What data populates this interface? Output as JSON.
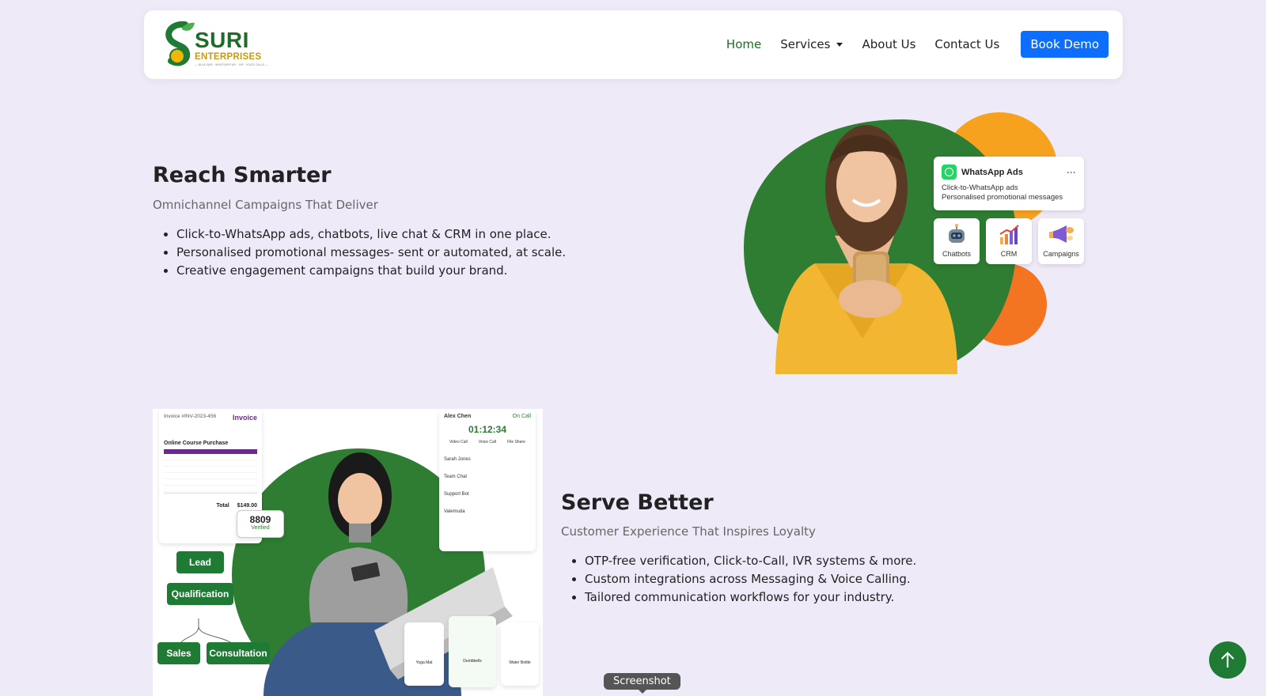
{
  "nav": {
    "logo": {
      "name": "SURI",
      "sub": "ENTERPRISES",
      "tag": "— BULK SMS · WHATSAPP API · IVR · VOICE CALLS —"
    },
    "links": [
      {
        "label": "Home",
        "active": true
      },
      {
        "label": "Services",
        "dropdown": true
      },
      {
        "label": "About Us"
      },
      {
        "label": "Contact Us"
      }
    ],
    "cta": "Book Demo"
  },
  "section1": {
    "title": "Reach Smarter",
    "subtitle": "Omnichannel Campaigns That Deliver",
    "bullets": [
      "Click-to-WhatsApp ads, chatbots, live chat & CRM in one place.",
      "Personalised promotional messages- sent or automated, at scale.",
      "Creative engagement campaigns that build your brand."
    ],
    "image": {
      "wa_card": {
        "title": "WhatsApp Ads",
        "line1": "Click-to-WhatsApp ads",
        "line2": "Personalised promotional messages"
      },
      "mini_cards": [
        "Chatbots",
        "CRM",
        "Campaigns"
      ]
    }
  },
  "section2": {
    "title": "Serve Better",
    "subtitle": "Customer Experience That Inspires Loyalty",
    "bullets": [
      "OTP-free verification, Click-to-Call, IVR systems & more.",
      "Custom integrations across Messaging & Voice Calling.",
      "Tailored communication workflows for your industry."
    ],
    "image": {
      "invoice": {
        "number": "Invoice #INV-2023-456",
        "label": "Invoice",
        "item": "Online Course Purchase",
        "total_label": "Total",
        "total_value": "$149.00"
      },
      "otp": {
        "code": "8809",
        "status": "Verified"
      },
      "call": {
        "name": "Alex Chen",
        "status": "On Call",
        "timer": "01:12:34",
        "actions": [
          "Video Call",
          "Voice Call",
          "File Share"
        ]
      },
      "chats": [
        "Sarah Jones",
        "Team Chat",
        "Support Bot",
        "Valemuda"
      ],
      "flow": [
        "Lead",
        "Qualification",
        "Sales",
        "Consultation"
      ],
      "products": [
        "Yoga Mat",
        "Dumbbells",
        "Water Bottle"
      ]
    }
  },
  "tooltip": "Screenshot",
  "colors": {
    "brand_green": "#1f7a34",
    "accent_blue": "#0d6efd",
    "orange": "#f7a21e",
    "page_bg": "#efeaf8"
  }
}
